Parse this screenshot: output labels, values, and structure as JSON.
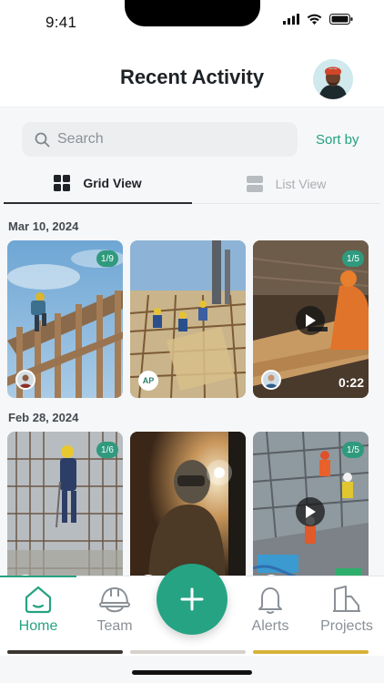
{
  "status_bar": {
    "time": "9:41"
  },
  "header": {
    "title": "Recent Activity"
  },
  "search": {
    "placeholder": "Search",
    "sort_label": "Sort by"
  },
  "view_toggle": {
    "grid_label": "Grid View",
    "list_label": "List View",
    "active": "grid"
  },
  "groups": [
    {
      "date": "Mar 10, 2024",
      "items": [
        {
          "count": "1/9",
          "badge": "avatar",
          "video": false
        },
        {
          "count": "",
          "badge": "initials",
          "initials": "AP",
          "video": false
        },
        {
          "count": "1/5",
          "badge": "avatar",
          "video": true,
          "duration": "0:22"
        }
      ]
    },
    {
      "date": "Feb 28, 2024",
      "items": [
        {
          "count": "1/6",
          "badge": "avatar",
          "video": false
        },
        {
          "count": "",
          "badge": "avatar",
          "video": false
        },
        {
          "count": "1/5",
          "badge": "avatar",
          "video": true
        }
      ]
    }
  ],
  "tabbar": {
    "items": [
      {
        "label": "Home",
        "icon": "home-icon",
        "active": true
      },
      {
        "label": "Team",
        "icon": "hard-hat-icon",
        "active": false
      },
      {
        "label": "",
        "icon": "plus-icon",
        "active": false
      },
      {
        "label": "Alerts",
        "icon": "bell-icon",
        "active": false
      },
      {
        "label": "Projects",
        "icon": "buildings-icon",
        "active": false
      }
    ]
  },
  "colors": {
    "accent": "#27a282",
    "badge": "#2f9a7d",
    "background": "#f6f7f8"
  }
}
